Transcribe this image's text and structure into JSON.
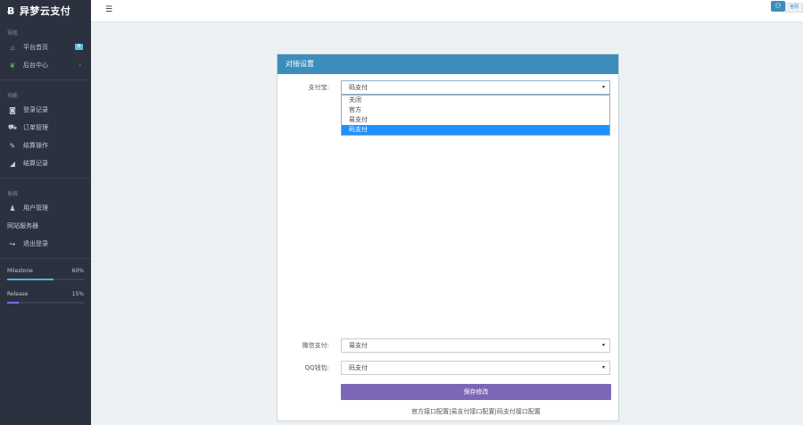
{
  "brand": {
    "name": "异梦云支付",
    "icon": "b-icon"
  },
  "sidebar": {
    "section1": "导航",
    "items1": [
      {
        "label": "平台首页",
        "icon": "home-icon",
        "badge": "N"
      },
      {
        "label": "后台中心",
        "icon": "leaf-icon"
      }
    ],
    "section2": "功能",
    "items2": [
      {
        "label": "登录记录",
        "icon": "camera-icon"
      },
      {
        "label": "订单管理",
        "icon": "cart-icon"
      },
      {
        "label": "结算操作",
        "icon": "edit-icon"
      },
      {
        "label": "结算记录",
        "icon": "chart-icon"
      }
    ],
    "section3": "系统",
    "items3": [
      {
        "label": "用户管理",
        "icon": "user-icon"
      }
    ],
    "plain_item": "网站服务器",
    "logout": {
      "label": "退出登录",
      "icon": "logout-icon"
    },
    "progress": [
      {
        "name": "Milestone",
        "percent_text": "60%",
        "value": 60,
        "color": "#46b8da"
      },
      {
        "name": "Release",
        "percent_text": "15%",
        "value": 15,
        "color": "#7c6cff"
      }
    ]
  },
  "topbar": {
    "menu_icon": "list-icon",
    "right_icon": "users-icon",
    "right_text": "官网"
  },
  "panel": {
    "title": "对接设置",
    "alipay": {
      "label": "支付宝:",
      "value": "码支付",
      "options": [
        "关闭",
        "官方",
        "易支付",
        "码支付"
      ],
      "selected_index": 3
    },
    "wechat": {
      "label": "微信支付:",
      "value": "易支付"
    },
    "qq": {
      "label": "QQ钱包:",
      "value": "码支付"
    },
    "save_label": "保存修改",
    "footnote": "官方接口配置|易支付接口配置|码支付接口配置"
  }
}
